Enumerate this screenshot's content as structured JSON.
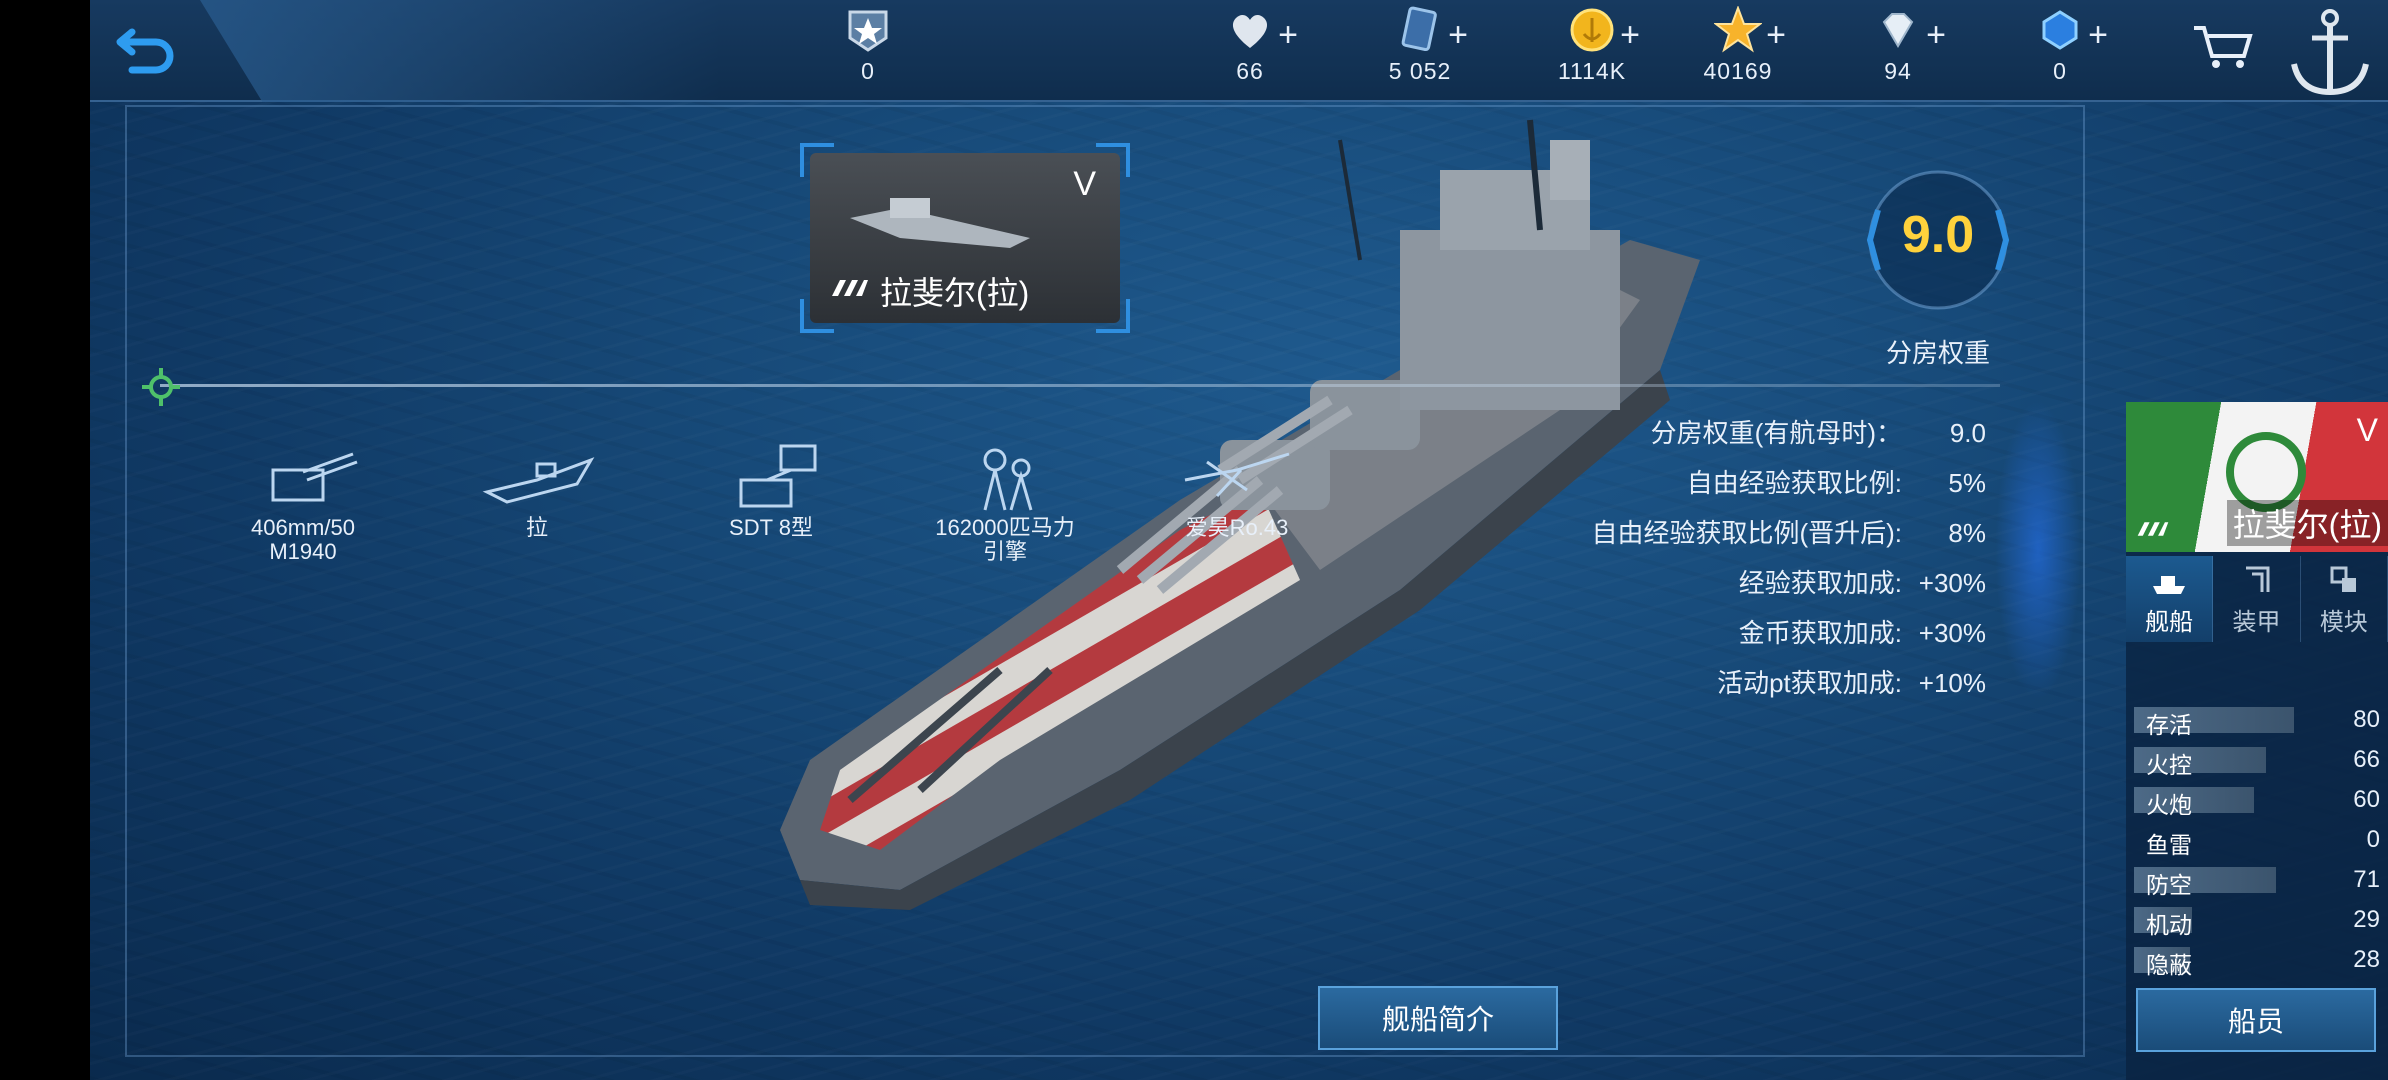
{
  "resources": [
    {
      "name": "rank",
      "value": "0",
      "icon": "rank-badge-icon"
    },
    {
      "name": "hearts",
      "value": "66",
      "icon": "heart-icon"
    },
    {
      "name": "cards",
      "value": "5 052",
      "icon": "card-icon"
    },
    {
      "name": "gold",
      "value": "1114K",
      "icon": "gold-coin-icon"
    },
    {
      "name": "stars",
      "value": "40169",
      "icon": "star-icon"
    },
    {
      "name": "diamonds",
      "value": "94",
      "icon": "diamond-icon"
    },
    {
      "name": "blue-crystal",
      "value": "0",
      "icon": "blue-crystal-icon"
    }
  ],
  "plus_sign": "+",
  "ship_card": {
    "tier": "V",
    "name": "拉斐尔(拉)"
  },
  "weight": {
    "value": "9.0",
    "label": "分房权重"
  },
  "equipment": [
    {
      "label": "406mm/50\nM1940",
      "icon": "gun-turret-icon"
    },
    {
      "label": "拉",
      "icon": "hull-icon"
    },
    {
      "label": "SDT 8型",
      "icon": "radar-icon"
    },
    {
      "label": "162000匹马力\n引擎",
      "icon": "engine-icon"
    },
    {
      "label": "爱昊Ro.43",
      "icon": "seaplane-icon"
    }
  ],
  "stats": [
    {
      "label": "分房权重(有航母时)：",
      "value": "9.0"
    },
    {
      "label": "自由经验获取比例:",
      "value": "5%"
    },
    {
      "label": "自由经验获取比例(晋升后):",
      "value": "8%"
    },
    {
      "label": "经验获取加成:",
      "value": "+30%"
    },
    {
      "label": "金币获取加成:",
      "value": "+30%"
    },
    {
      "label": "活动pt获取加成:",
      "value": "+10%"
    }
  ],
  "intro_button": "舰船简介",
  "side_panel": {
    "tier": "V",
    "name": "拉斐尔(拉)",
    "tabs": [
      {
        "label": "舰船",
        "icon": "ship-tab-icon",
        "active": true
      },
      {
        "label": "装甲",
        "icon": "armor-tab-icon",
        "active": false
      },
      {
        "label": "模块",
        "icon": "module-tab-icon",
        "active": false
      }
    ],
    "attributes": [
      {
        "label": "存活",
        "value": "80",
        "level": 0.8
      },
      {
        "label": "火控",
        "value": "66",
        "level": 0.66
      },
      {
        "label": "火炮",
        "value": "60",
        "level": 0.6
      },
      {
        "label": "鱼雷",
        "value": "0",
        "level": 0.0
      },
      {
        "label": "防空",
        "value": "71",
        "level": 0.71
      },
      {
        "label": "机动",
        "value": "29",
        "level": 0.29
      },
      {
        "label": "隐蔽",
        "value": "28",
        "level": 0.28
      }
    ],
    "crew_button": "船员"
  },
  "colors": {
    "accent": "#2f8fe0",
    "gold": "#ffd23c",
    "button": "#1a4c79"
  }
}
